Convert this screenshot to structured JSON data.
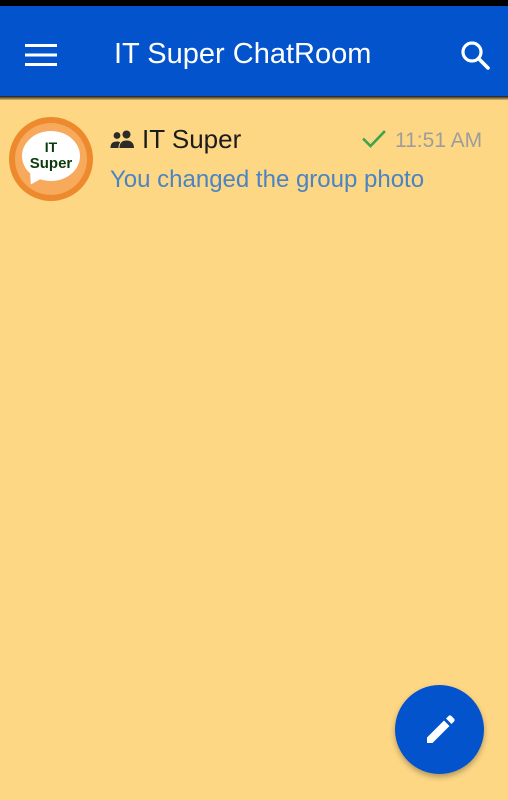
{
  "app_bar": {
    "title": "IT Super ChatRoom",
    "menu_icon": "hamburger-menu-icon",
    "search_icon": "search-icon",
    "background_color": "#0353cc"
  },
  "chat_list": {
    "background_color": "#fdd784",
    "items": [
      {
        "name": "IT Super",
        "type_icon": "group-icon",
        "status_icon": "check-icon",
        "time": "11:51 AM",
        "preview": "You changed the group photo",
        "avatar": {
          "line1": "IT",
          "line2": "Super",
          "ring_color": "#ee8a2e"
        }
      }
    ]
  },
  "fab": {
    "icon": "pencil-icon",
    "background_color": "#0353cc"
  }
}
